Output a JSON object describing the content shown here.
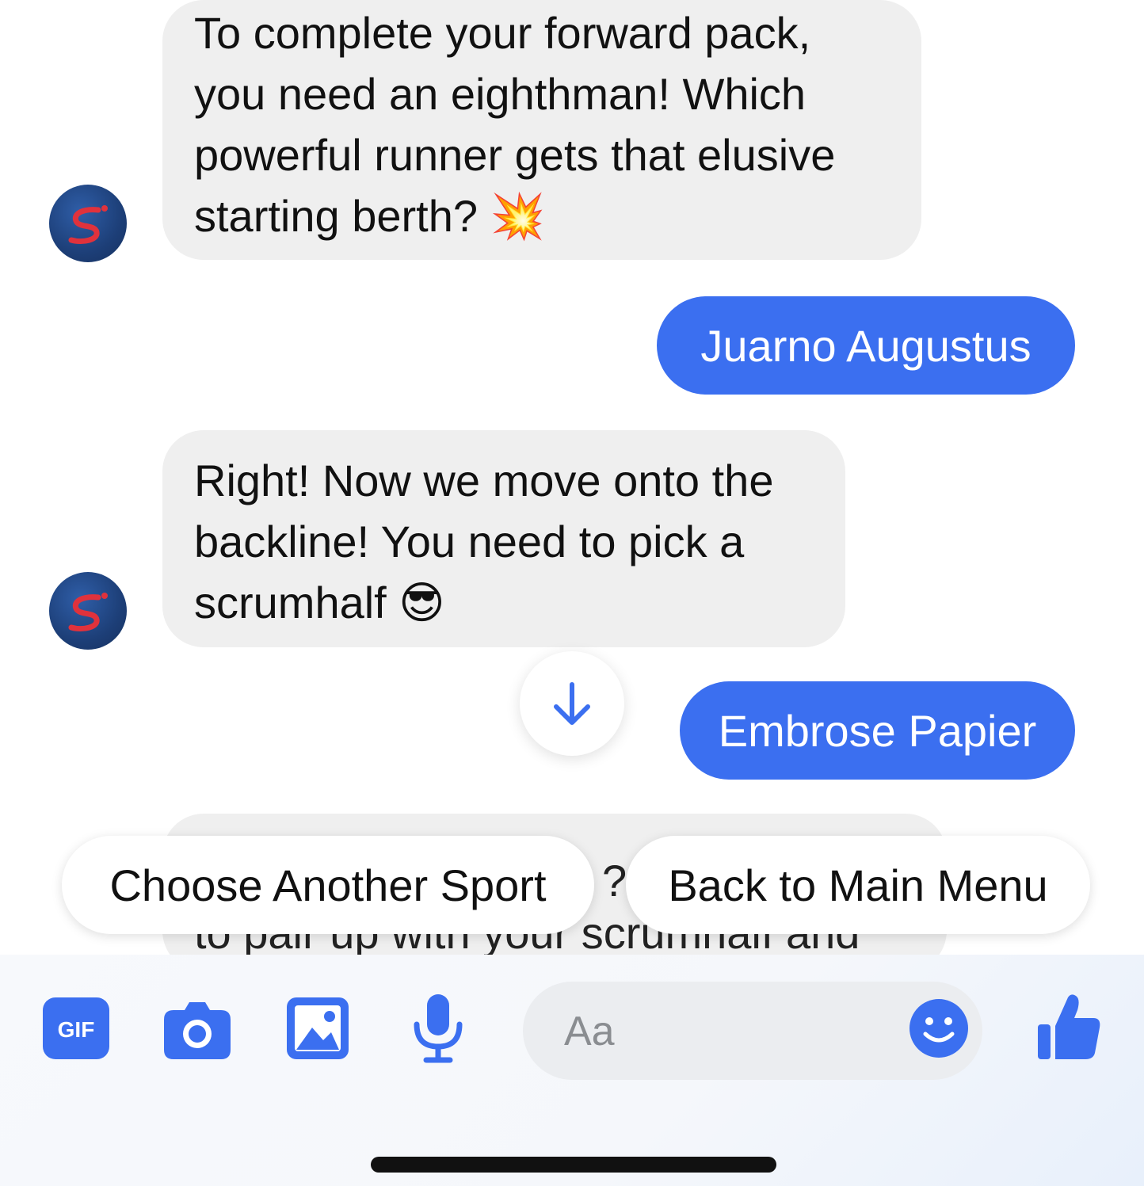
{
  "messages": [
    {
      "sender": "bot",
      "text": "To complete your forward pack, you need an eighthman! Which powerful runner gets that elusive starting berth? 💥"
    },
    {
      "sender": "user",
      "text": "Juarno Augustus"
    },
    {
      "sender": "bot",
      "text": "Right! Now we move onto the backline! You need to pick a scrumhalf 😎"
    },
    {
      "sender": "user",
      "text": "Embrose Papier"
    },
    {
      "sender": "bot",
      "partial_text_top": "? I",
      "partial_text_bottom": "to pair up with your scrumhalf and"
    }
  ],
  "quick_replies": [
    {
      "label": "Choose Another Sport"
    },
    {
      "label": "Back to Main Menu"
    }
  ],
  "composer": {
    "placeholder": "Aa",
    "tools": [
      "gif-icon",
      "camera-icon",
      "image-icon",
      "microphone-icon"
    ],
    "emoji_icon": "smiley-icon",
    "like_icon": "thumbs-up-icon",
    "gif_label": "GIF"
  },
  "colors": {
    "accent": "#3b6ff0",
    "incoming_bubble": "#efefef",
    "avatar": "#1d3f78",
    "logo_stroke": "#e0323c"
  }
}
